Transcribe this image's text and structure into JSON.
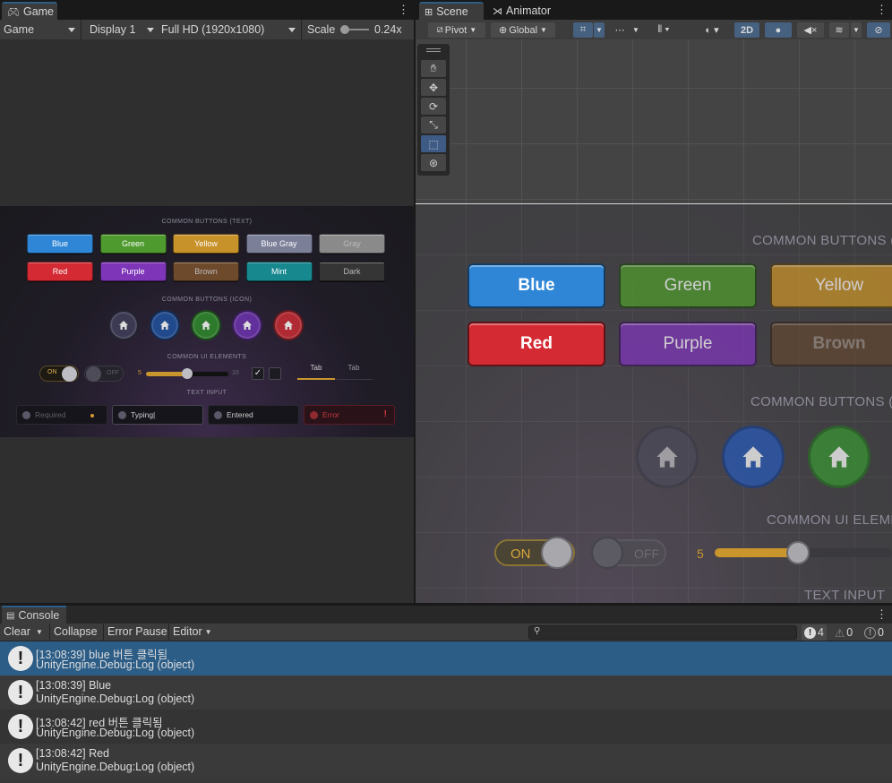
{
  "game_panel": {
    "tab_label": "Game",
    "toolbar": {
      "mode": "Game",
      "display": "Display 1",
      "resolution": "Full HD (1920x1080)",
      "scale_label": "Scale",
      "scale_value": "0.24x"
    },
    "canvas": {
      "section_text_buttons": "COMMON BUTTONS (TEXT)",
      "text_buttons": [
        {
          "label": "Blue",
          "color": "#2f86d6"
        },
        {
          "label": "Green",
          "color": "#4f9a2e"
        },
        {
          "label": "Yellow",
          "color": "#c8922a"
        },
        {
          "label": "Blue Gray",
          "color": "#7b7f98"
        },
        {
          "label": "Gray",
          "color": "#8a8a8a"
        },
        {
          "label": "Red",
          "color": "#d42a33"
        },
        {
          "label": "Purple",
          "color": "#7e35b8"
        },
        {
          "label": "Brown",
          "color": "#6e4a2c"
        },
        {
          "label": "Mint",
          "color": "#16888e"
        },
        {
          "label": "Dark",
          "color": "#353535"
        }
      ],
      "section_icon_buttons": "COMMON BUTTONS (ICON)",
      "icon_button_colors": [
        "#3b3a52",
        "#214a8d",
        "#2e7a2c",
        "#62309b",
        "#b02a33"
      ],
      "section_ui_elements": "COMMON UI ELEMENTS",
      "toggle_on": "ON",
      "toggle_off": "OFF",
      "slider_min": "5",
      "slider_max": "10",
      "slider_fraction": 0.5,
      "tab_1": "Tab",
      "tab_2": "Tab",
      "section_text_input": "TEXT INPUT",
      "inputs": [
        {
          "text": "Required"
        },
        {
          "text": "Typing|"
        },
        {
          "text": "Entered"
        },
        {
          "text": "Error"
        }
      ]
    }
  },
  "scene_panel": {
    "tab_scene": "Scene",
    "tab_animator": "Animator",
    "toolbar": {
      "pivot": "Pivot",
      "global": "Global",
      "two_d": "2D"
    },
    "canvas": {
      "section_text_buttons": "COMMON BUTTONS (T",
      "buttons": [
        {
          "label": "Blue",
          "color": "#2f86d6"
        },
        {
          "label": "Green",
          "color": "#4f9a2e"
        },
        {
          "label": "Yellow",
          "color": "#c8922a"
        },
        {
          "label": "Red",
          "color": "#d42a33"
        },
        {
          "label": "Purple",
          "color": "#7e35b8"
        },
        {
          "label": "Brown",
          "color": "#6e4a2c"
        }
      ],
      "section_icon_buttons": "COMMON BUTTONS (I",
      "icon_colors": [
        "#4d4d5e",
        "#2c56a8",
        "#3a8a36"
      ],
      "section_ui_elements": "COMMON UI ELEME",
      "toggle_on": "ON",
      "toggle_off": "OFF",
      "slider_min": "5",
      "section_text_input": "TEXT INPUT"
    }
  },
  "console": {
    "tab_label": "Console",
    "buttons": {
      "clear": "Clear",
      "collapse": "Collapse",
      "error_pause": "Error Pause",
      "editor": "Editor"
    },
    "counts": {
      "info": "4",
      "warning": "0",
      "error": "0"
    },
    "logs": [
      {
        "line1": "[13:08:39] blue 버튼 클릭됨",
        "line2": "UnityEngine.Debug:Log (object)"
      },
      {
        "line1": "[13:08:39] Blue",
        "line2": "UnityEngine.Debug:Log (object)"
      },
      {
        "line1": "[13:08:42] red 버튼 클릭됨",
        "line2": "UnityEngine.Debug:Log (object)"
      },
      {
        "line1": "[13:08:42] Red",
        "line2": "UnityEngine.Debug:Log (object)"
      }
    ]
  }
}
